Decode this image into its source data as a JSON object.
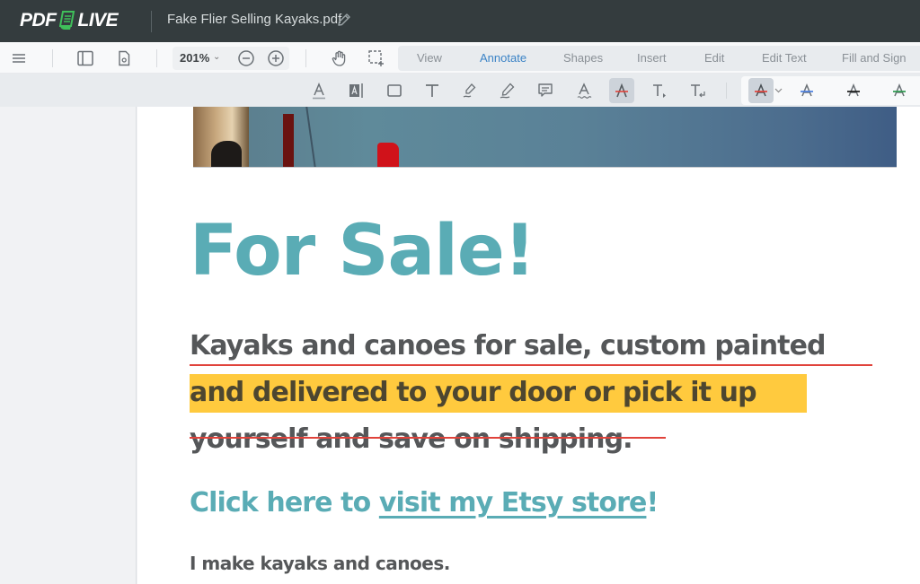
{
  "app": {
    "logo_left": "PDF",
    "logo_right": "LIVE",
    "document_title": "Fake Flier Selling Kayaks.pdf"
  },
  "toolbar": {
    "zoom_level": "201%",
    "zoom_chevron": "⌄",
    "tabs": [
      {
        "label": "View",
        "active": false
      },
      {
        "label": "Annotate",
        "active": true
      },
      {
        "label": "Shapes",
        "active": false
      },
      {
        "label": "Insert",
        "active": false
      },
      {
        "label": "Edit",
        "active": false
      },
      {
        "label": "Edit Text",
        "active": false
      },
      {
        "label": "Fill and Sign",
        "active": false
      }
    ]
  },
  "annotate_tools": [
    {
      "name": "underline-text",
      "selected": false
    },
    {
      "name": "text-box",
      "selected": false
    },
    {
      "name": "rectangle",
      "selected": false
    },
    {
      "name": "free-text",
      "selected": false
    },
    {
      "name": "highlighter",
      "selected": false
    },
    {
      "name": "pen",
      "selected": false
    },
    {
      "name": "comment",
      "selected": false
    },
    {
      "name": "squiggly",
      "selected": false
    },
    {
      "name": "strikethrough",
      "selected": true
    },
    {
      "name": "insert-text",
      "selected": false
    },
    {
      "name": "replace-text",
      "selected": false
    }
  ],
  "color_presets": [
    {
      "color": "#e0433b",
      "selected": true
    },
    {
      "color": "#4a7fe0",
      "selected": false
    },
    {
      "color": "#1a1a1a",
      "selected": false
    },
    {
      "color": "#2e9b4f",
      "selected": false
    }
  ],
  "document": {
    "heading": "For Sale!",
    "line1": "Kayaks and canoes for sale, custom painted",
    "line2": "and delivered to your door or pick it up",
    "line3": "yourself and save on shipping.",
    "cta_prefix": "Click here to ",
    "cta_link": "visit my Etsy store",
    "cta_suffix": "!",
    "paragraph": "I make kayaks and canoes."
  },
  "colors": {
    "heading": "#5aacb5",
    "highlight": "#ffca3e",
    "annotation_red": "#e0433b",
    "active_tab": "#3b83c6",
    "appbar": "#343c3e"
  }
}
